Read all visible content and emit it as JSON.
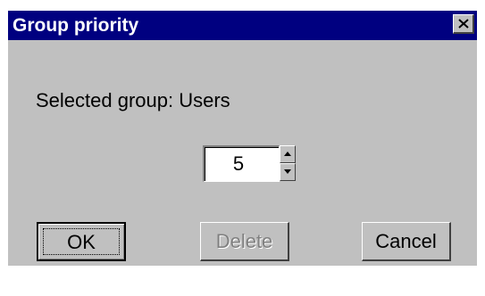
{
  "window": {
    "title": "Group priority",
    "close_icon": "close-icon",
    "colors": {
      "titlebar": "#000080",
      "face": "#c0c0c0",
      "disabled_text": "#808080"
    }
  },
  "content": {
    "selected_group_label": "Selected group: Users",
    "priority": {
      "value": "5",
      "up_icon": "arrow-up-icon",
      "down_icon": "arrow-down-icon"
    }
  },
  "buttons": {
    "ok": "OK",
    "delete": "Delete",
    "cancel": "Cancel",
    "delete_enabled": false
  }
}
